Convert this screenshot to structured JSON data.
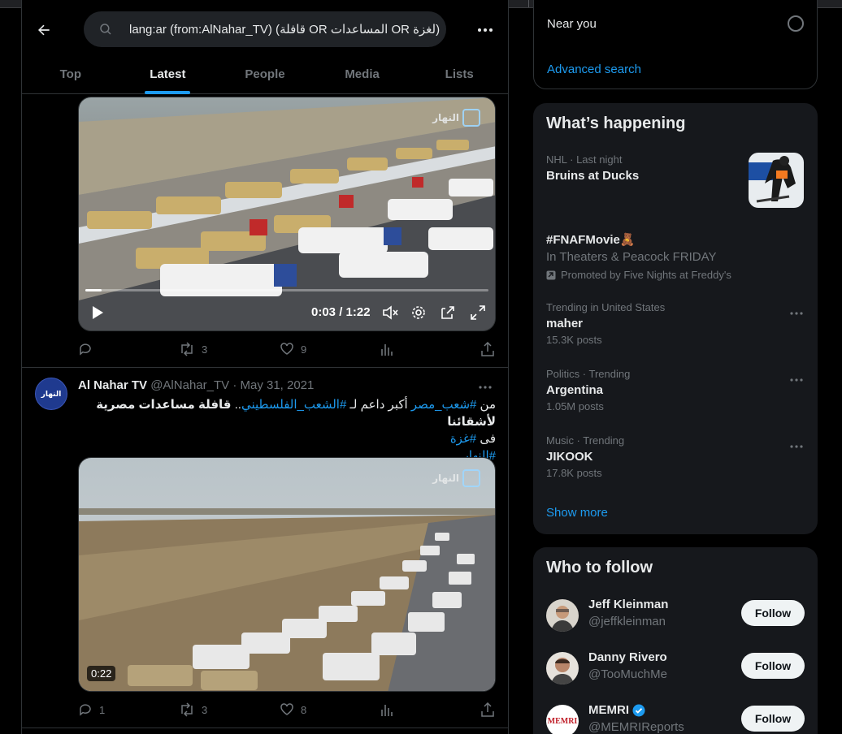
{
  "search": {
    "query": "lang:ar (from:AlNahar_TV) (قافلة OR المساعدات OR لغزة)"
  },
  "tabs": [
    {
      "label": "Top"
    },
    {
      "label": "Latest"
    },
    {
      "label": "People"
    },
    {
      "label": "Media"
    },
    {
      "label": "Lists"
    }
  ],
  "tweet1": {
    "watermark": "النهار",
    "video_time": "0:03 / 1:22",
    "progress": 0.04,
    "replies": "",
    "retweets": "3",
    "likes": "9"
  },
  "tweet2": {
    "avatar_text": "النهار",
    "name": "Al Nahar TV",
    "handle": "@AlNahar_TV",
    "date": "· May 31, 2021",
    "text_part1": "من ",
    "hashtag1": "#شعب_مصر",
    "text_part2": " أكبر داعم لـ ",
    "hashtag2": "#الشعب_الفلسطيني",
    "text_part3": ".. ",
    "bold_text": "قافلة",
    "text_part4": " مساعدات مصرية لأشقائنا",
    "line2_prefix": "فى ",
    "hashtag3": "#غزة",
    "hashtag4": "#النهار",
    "watermark": "النهار",
    "duration": "0:22",
    "replies": "1",
    "retweets": "3",
    "likes": "8"
  },
  "sidebar": {
    "near_you": "Near you",
    "advanced_search": "Advanced search",
    "happening_title": "What’s happening",
    "trends": [
      {
        "meta": "NHL · Last night",
        "title": "Bruins at Ducks"
      },
      {
        "title": "#FNAFMovie🧸",
        "sub": "In Theaters & Peacock FRIDAY",
        "promo": "Promoted by Five Nights at Freddy's"
      },
      {
        "meta": "Trending in United States",
        "title": "maher",
        "count": "15.3K posts"
      },
      {
        "meta": "Politics · Trending",
        "title": "Argentina",
        "count": "1.05M posts"
      },
      {
        "meta": "Music · Trending",
        "title": "JIKOOK",
        "count": "17.8K posts"
      }
    ],
    "show_more": "Show more",
    "who_to_follow": "Who to follow",
    "follow": [
      {
        "name": "Jeff Kleinman",
        "handle": "@jeffkleinman",
        "button": "Follow"
      },
      {
        "name": "Danny Rivero",
        "handle": "@TooMuchMe",
        "button": "Follow"
      },
      {
        "name": "MEMRI",
        "handle": "@MEMRIReports",
        "button": "Follow",
        "avatar_text": "MEMRI"
      }
    ]
  },
  "colors": {
    "accent": "#1d9bf0",
    "background": "#000000",
    "card": "#16181c"
  }
}
